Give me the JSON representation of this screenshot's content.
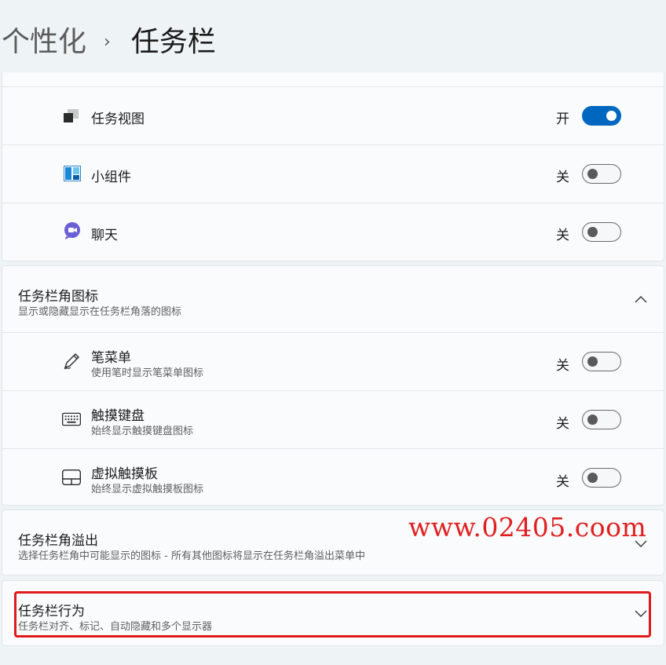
{
  "breadcrumb": {
    "parent": "个性化",
    "separator": "›",
    "current": "任务栏"
  },
  "taskbar_items": [
    {
      "label": "任务视图",
      "state": "开",
      "on": true,
      "icon": "task-view-icon"
    },
    {
      "label": "小组件",
      "state": "关",
      "on": false,
      "icon": "widgets-icon"
    },
    {
      "label": "聊天",
      "state": "关",
      "on": false,
      "icon": "chat-icon"
    }
  ],
  "corner_icons": {
    "title": "任务栏角图标",
    "subtitle": "显示或隐藏显示在任务栏角落的图标",
    "items": [
      {
        "label": "笔菜单",
        "sub": "使用笔时显示笔菜单图标",
        "state": "关",
        "on": false,
        "icon": "pen-icon"
      },
      {
        "label": "触摸键盘",
        "sub": "始终显示触摸键盘图标",
        "state": "关",
        "on": false,
        "icon": "keyboard-icon"
      },
      {
        "label": "虚拟触摸板",
        "sub": "始终显示虚拟触摸板图标",
        "state": "关",
        "on": false,
        "icon": "touchpad-icon"
      }
    ]
  },
  "corner_overflow": {
    "title": "任务栏角溢出",
    "subtitle": "选择任务栏角中可能显示的图标 - 所有其他图标将显示在任务栏角溢出菜单中"
  },
  "behaviors": {
    "title": "任务栏行为",
    "subtitle": "任务栏对齐、标记、自动隐藏和多个显示器"
  },
  "watermark": "www.02405.coom",
  "colors": {
    "accent": "#0067c0",
    "highlight": "#e0191b",
    "watermark": "#e02020"
  }
}
